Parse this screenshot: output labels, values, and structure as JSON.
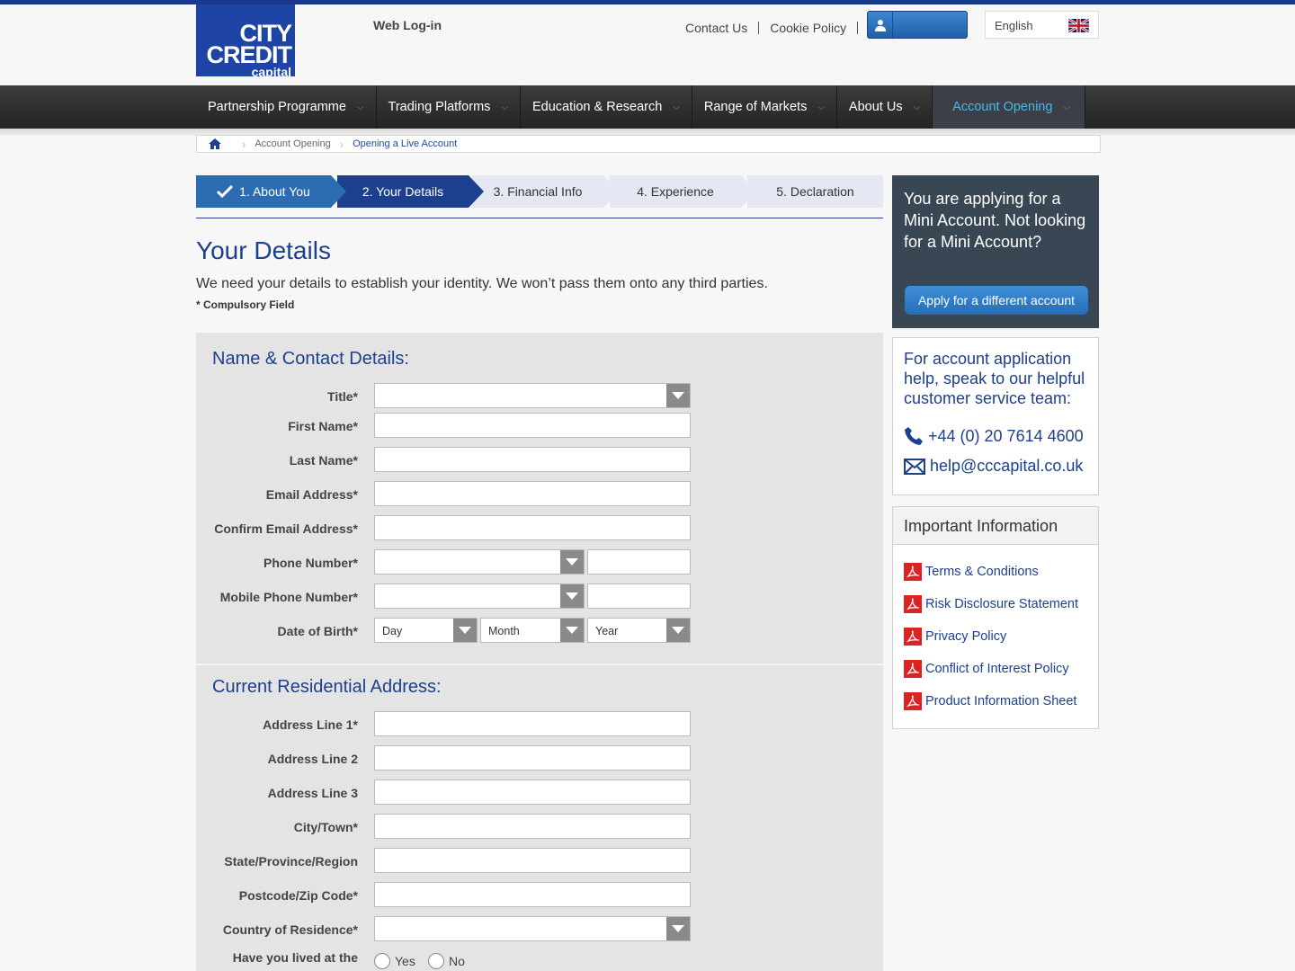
{
  "brand": {
    "line1": "CITY",
    "line2": "CREDIT",
    "line3": "capital"
  },
  "toplinks": {
    "contact": "Contact Us",
    "cookie": "Cookie Policy",
    "weblogin": "Web Log-in",
    "language": "English"
  },
  "nav": [
    {
      "label": "Partnership Programme"
    },
    {
      "label": "Trading Platforms"
    },
    {
      "label": "Education & Research"
    },
    {
      "label": "Range of Markets"
    },
    {
      "label": "About Us"
    },
    {
      "label": "Account Opening"
    }
  ],
  "breadcrumb": {
    "item1": "Account Opening",
    "item2": "Opening a Live Account"
  },
  "steps": [
    {
      "label": "1. About You"
    },
    {
      "label": "2. Your Details"
    },
    {
      "label": "3. Financial Info"
    },
    {
      "label": "4. Experience"
    },
    {
      "label": "5. Declaration"
    }
  ],
  "page": {
    "title": "Your Details",
    "intro": "We need your details to establish your identity. We won’t pass them onto any third parties.",
    "compulsory": "* Compulsory Field"
  },
  "form": {
    "section1": "Name & Contact Details:",
    "section2": "Current Residential Address:",
    "labels": {
      "title": "Title*",
      "first_name": "First Name*",
      "last_name": "Last Name*",
      "email": "Email Address*",
      "confirm_email": "Confirm Email Address*",
      "phone": "Phone Number*",
      "mobile": "Mobile Phone Number*",
      "dob": "Date of Birth*",
      "addr1": "Address Line 1*",
      "addr2": "Address Line 2",
      "addr3": "Address Line 3",
      "city": "City/Town*",
      "state": "State/Province/Region",
      "postcode": "Postcode/Zip Code*",
      "country": "Country of Residence*",
      "lived": "Have you lived at the"
    },
    "dob": {
      "day": "Day",
      "month": "Month",
      "year": "Year"
    },
    "radio": {
      "yes": "Yes",
      "no": "No"
    }
  },
  "sidebar": {
    "applying": "You are applying for a Mini Account. Not looking for a Mini Account?",
    "apply_btn": "Apply for a different account",
    "help": "For account application help, speak to our helpful customer service team:",
    "phone": "+44 (0) 20 7614 4600",
    "email": "help@cccapital.co.uk",
    "info_title": "Important Information",
    "docs": [
      {
        "label": "Terms & Conditions"
      },
      {
        "label": "Risk Disclosure Statement"
      },
      {
        "label": "Privacy Policy"
      },
      {
        "label": "Conflict of Interest Policy"
      },
      {
        "label": "Product Information Sheet"
      }
    ]
  },
  "colors": {
    "brand_blue": "#1c3f8e",
    "accent": "#4ab6ee",
    "nav_bg": "#2e2e2e"
  }
}
